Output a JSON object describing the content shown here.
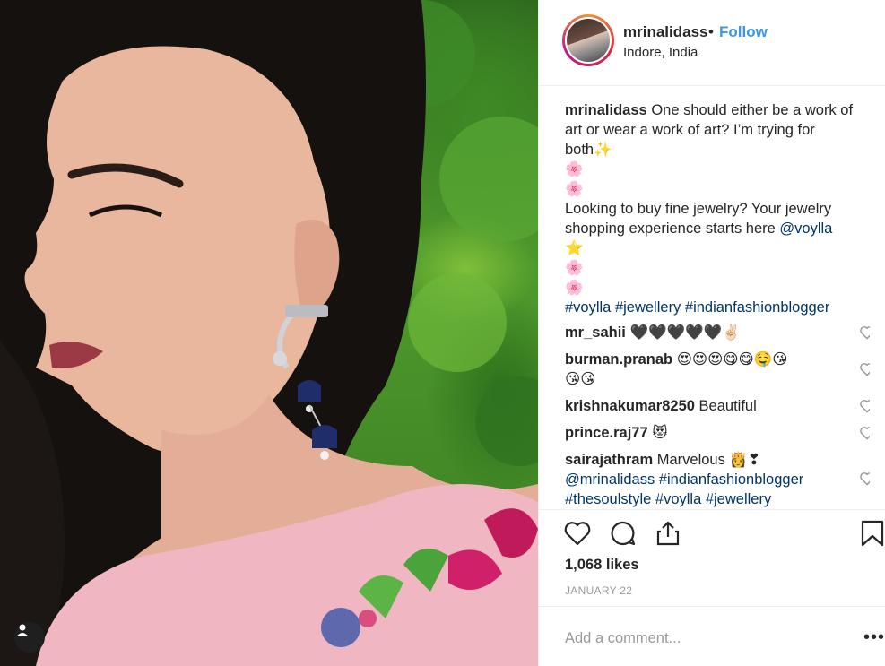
{
  "header": {
    "username": "mrinalidass",
    "separator": "•",
    "follow_label": "Follow",
    "location": "Indore, India"
  },
  "caption": {
    "username": "mrinalidass",
    "lines": [
      "One should either be a work of",
      "art or wear a work of art? I’m trying for",
      "both✨",
      "🌸",
      "🌸",
      "Looking to buy fine jewelry? Your jewelry",
      "shopping experience starts here",
      "⭐",
      "🌸",
      "🌸"
    ],
    "mention": "@voylla",
    "hashtags": "#voylla #jewellery #indianfashionblogger"
  },
  "comments": [
    {
      "username": "mr_sahii",
      "lines": [
        "🖤🖤🖤🖤🖤✌🏻"
      ]
    },
    {
      "username": "burman.pranab",
      "lines": [
        "😍😍😍😋😋🤤😘",
        "😘😘"
      ]
    },
    {
      "username": "krishnakumar8250",
      "lines": [
        "Beautiful"
      ]
    },
    {
      "username": "prince.raj77",
      "lines": [
        "😻"
      ]
    },
    {
      "username": "sairajathram",
      "lines": [
        "Marvelous 👸❣"
      ],
      "tag_lines": [
        "@mrinalidass #indianfashionblogger",
        "#thesoulstyle #voylla #jewellery"
      ]
    }
  ],
  "likes": "1,068 likes",
  "date": "JANUARY 22",
  "add_comment": {
    "placeholder": "Add a comment..."
  },
  "more_label": "•••",
  "colors": {
    "link": "#003569",
    "follow": "#3897f0",
    "muted": "#999999",
    "border": "#efefef"
  },
  "icons": [
    "heart-icon",
    "comment-icon",
    "share-icon",
    "bookmark-icon",
    "more-icon",
    "user-icon"
  ]
}
